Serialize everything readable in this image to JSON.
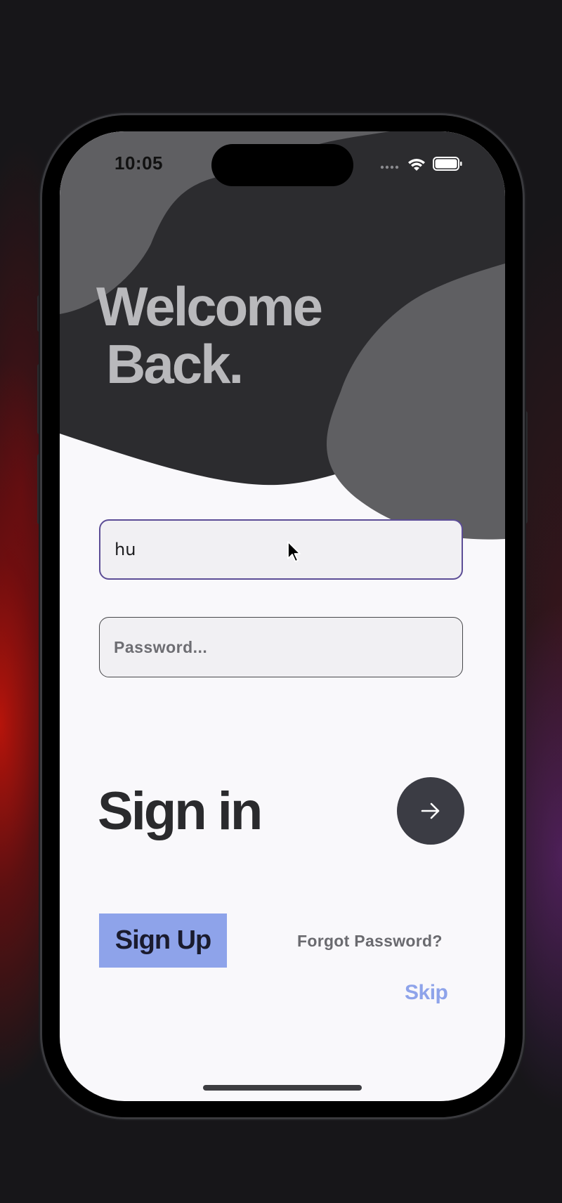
{
  "status_bar": {
    "time": "10:05",
    "icons": [
      "signal-dots-icon",
      "wifi-icon",
      "battery-icon"
    ]
  },
  "header": {
    "title_line1": "Welcome",
    "title_line2": "Back."
  },
  "form": {
    "email_value": "hu",
    "password_placeholder": "Password..."
  },
  "actions": {
    "sign_in_label": "Sign in",
    "submit_icon": "arrow-right-icon",
    "sign_up_label": "Sign Up",
    "forgot_password_label": "Forgot Password?",
    "skip_label": "Skip"
  },
  "colors": {
    "accent": "#8ea3ea",
    "dark_blob": "#2c2c2f",
    "mid_blob": "#5f5f62",
    "focus_border": "#5c4d96",
    "submit_button": "#3b3c44"
  }
}
